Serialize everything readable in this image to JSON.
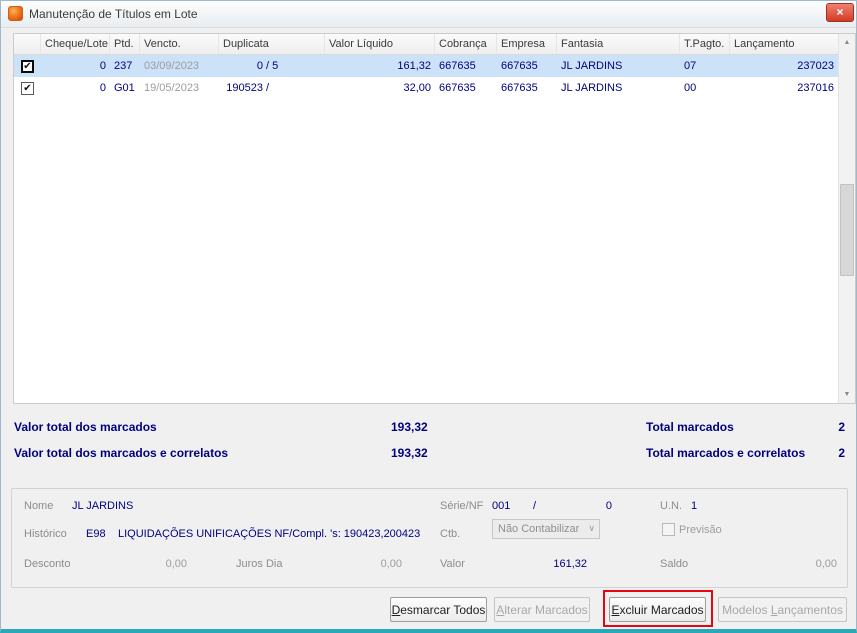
{
  "window": {
    "title": "Manutenção de Títulos em Lote"
  },
  "icons": {
    "close": "×",
    "check": "✔",
    "scroll_up": "▲",
    "scroll_down": "▼",
    "combo_arrow": "∨"
  },
  "grid": {
    "columns": [
      "Cheque/Lote",
      "Ptd.",
      "Vencto.",
      "Duplicata",
      "Valor Líquido",
      "Cobrança",
      "Empresa",
      "Fantasia",
      "T.Pagto.",
      "Lançamento"
    ],
    "rows": [
      {
        "checked": true,
        "selected": true,
        "cheque_lote": "0",
        "ptd": "237",
        "vencto": "03/09/2023",
        "dup_num": "0",
        "dup_sep": "/",
        "dup_par": "5",
        "valor_liquido": "161,32",
        "cobranca": "667635",
        "empresa": "667635",
        "fantasia": "JL JARDINS",
        "t_pagto": "07",
        "lancamento": "237023"
      },
      {
        "checked": true,
        "selected": false,
        "cheque_lote": "0",
        "ptd": "G01",
        "vencto": "19/05/2023",
        "dup_num": "190523",
        "dup_sep": "/",
        "dup_par": "",
        "valor_liquido": "32,00",
        "cobranca": "667635",
        "empresa": "667635",
        "fantasia": "JL JARDINS",
        "t_pagto": "00",
        "lancamento": "237016"
      }
    ]
  },
  "totals": {
    "marcados_label": "Valor total dos marcados",
    "marcados_value": "193,32",
    "marcados_count_label": "Total marcados",
    "marcados_count": "2",
    "correlatos_label": "Valor total dos marcados e correlatos",
    "correlatos_value": "193,32",
    "correlatos_count_label": "Total marcados e correlatos",
    "correlatos_count": "2"
  },
  "detail": {
    "nome_label": "Nome",
    "nome_value": "JL JARDINS",
    "serie_label": "Série/NF",
    "serie_value": "001",
    "serie_sep": "/",
    "nf_value": "0",
    "un_label": "U.N.",
    "un_value": "1",
    "historico_label": "Histórico",
    "historico_code": "E98",
    "historico_text": "LIQUIDAÇÕES UNIFICAÇÕES NF/Compl. 's: 190423,200423",
    "ctb_label": "Ctb.",
    "ctb_value": "Não Contabilizar",
    "previsao_label": "Previsão",
    "desconto_label": "Desconto",
    "desconto_value": "0,00",
    "juros_label": "Juros Dia",
    "juros_value": "0,00",
    "valor_label": "Valor",
    "valor_value": "161,32",
    "saldo_label": "Saldo",
    "saldo_value": "0,00"
  },
  "buttons": {
    "desmarcar": "Desmarcar Todos",
    "alterar": "Alterar Marcados",
    "excluir": "Excluir Marcados",
    "modelos": "Modelos Lançamentos"
  }
}
